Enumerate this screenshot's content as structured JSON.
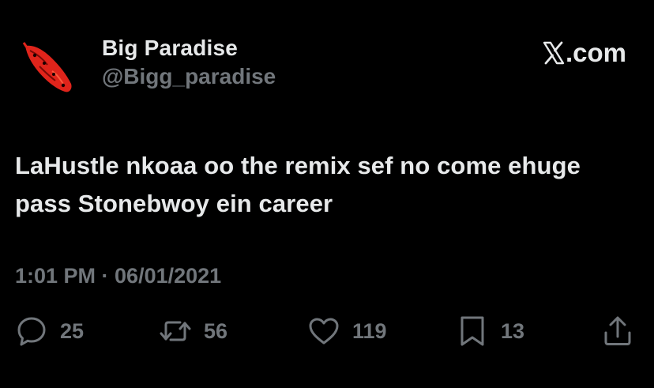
{
  "author": {
    "display_name": "Big Paradise",
    "handle": "@Bigg_paradise",
    "avatar_icon": "red-leaf-avatar-icon"
  },
  "platform": {
    "label": ".com",
    "icon": "x-logo-icon"
  },
  "tweet": {
    "text": "LaHustle nkoaa oo the remix sef no come ehuge pass Stonebwoy ein career",
    "timestamp": "1:01 PM · 06/01/2021"
  },
  "actions": {
    "replies": "25",
    "reposts": "56",
    "likes": "119",
    "bookmarks": "13"
  },
  "colors": {
    "background": "#000000",
    "primary_text": "#e7e9ea",
    "secondary_text": "#71767b",
    "avatar_red": "#e0241b"
  }
}
